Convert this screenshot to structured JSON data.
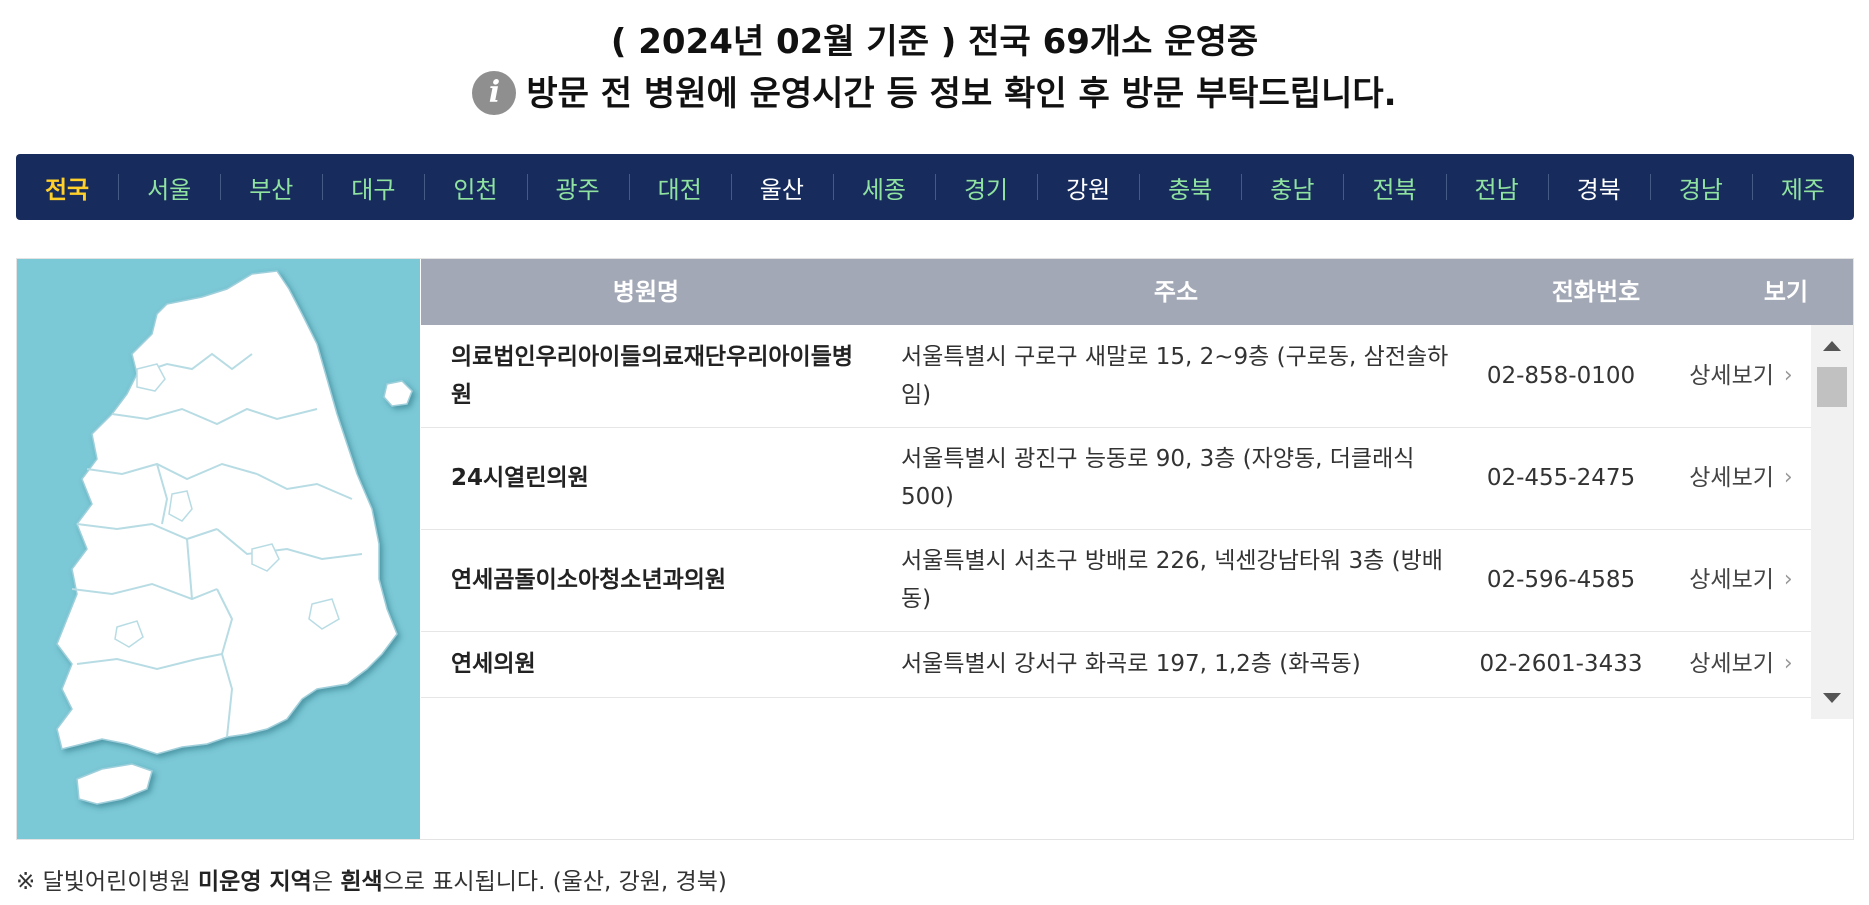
{
  "header": {
    "title": "( 2024년 02월 기준 ) 전국 69개소 운영중",
    "notice": "방문 전 병원에 운영시간 등 정보 확인 후 방문 부탁드립니다.",
    "info_icon": "i"
  },
  "nav": {
    "items": [
      {
        "label": "전국",
        "active": true,
        "operating": true
      },
      {
        "label": "서울",
        "operating": true
      },
      {
        "label": "부산",
        "operating": true
      },
      {
        "label": "대구",
        "operating": true
      },
      {
        "label": "인천",
        "operating": true
      },
      {
        "label": "광주",
        "operating": true
      },
      {
        "label": "대전",
        "operating": true
      },
      {
        "label": "울산",
        "operating": false
      },
      {
        "label": "세종",
        "operating": true
      },
      {
        "label": "경기",
        "operating": true
      },
      {
        "label": "강원",
        "operating": false
      },
      {
        "label": "충북",
        "operating": true
      },
      {
        "label": "충남",
        "operating": true
      },
      {
        "label": "전북",
        "operating": true
      },
      {
        "label": "전남",
        "operating": true
      },
      {
        "label": "경북",
        "operating": false
      },
      {
        "label": "경남",
        "operating": true
      },
      {
        "label": "제주",
        "operating": true
      }
    ],
    "colors": {
      "background": "#172c5c",
      "active": "#ffcf2a",
      "operating": "#8fe2a0",
      "inactive": "#ffffff"
    }
  },
  "table": {
    "columns": [
      "병원명",
      "주소",
      "전화번호",
      "보기"
    ],
    "rows": [
      {
        "name": "의료법인우리아이들의료재단우리아이들병원",
        "address": "서울특별시 구로구 새말로 15, 2~9층 (구로동, 삼전솔하임)",
        "phone": "02-858-0100",
        "view": "상세보기"
      },
      {
        "name": "24시열린의원",
        "address": "서울특별시 광진구 능동로 90, 3층 (자양동, 더클래식500)",
        "phone": "02-455-2475",
        "view": "상세보기"
      },
      {
        "name": "연세곰돌이소아청소년과의원",
        "address": "서울특별시 서초구 방배로 226, 넥센강남타워 3층 (방배동)",
        "phone": "02-596-4585",
        "view": "상세보기"
      },
      {
        "name": "연세의원",
        "address": "서울특별시 강서구 화곡로 197, 1,2층 (화곡동)",
        "phone": "02-2601-3433",
        "view": "상세보기"
      }
    ],
    "header_color": "#a2a8b5"
  },
  "map": {
    "sea_color": "#7bc8d6",
    "land_color": "#ffffff",
    "border_color": "#b8dce4"
  },
  "footnote": {
    "prefix": "※ 달빛어린이병원 ",
    "bold1": "미운영 지역",
    "mid": "은 ",
    "bold2": "흰색",
    "suffix": "으로 표시됩니다. (울산, 강원, 경북)"
  }
}
